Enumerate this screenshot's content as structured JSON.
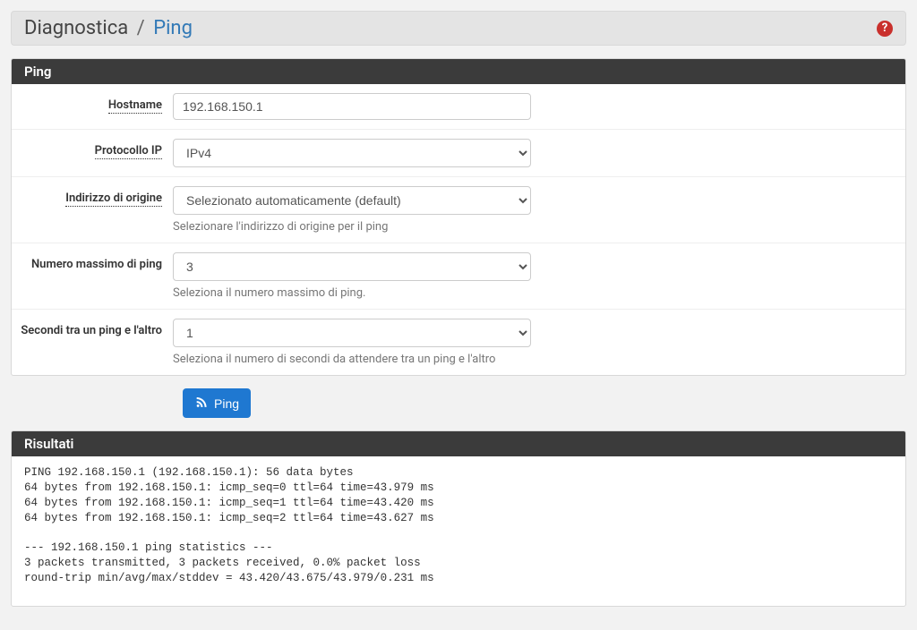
{
  "breadcrumb": {
    "parent": "Diagnostica",
    "separator": "/",
    "current": "Ping"
  },
  "panels": {
    "ping_title": "Ping",
    "results_title": "Risultati"
  },
  "form": {
    "hostname": {
      "label": "Hostname",
      "value": "192.168.150.1"
    },
    "protocol": {
      "label": "Protocollo IP",
      "value": "IPv4"
    },
    "source": {
      "label": "Indirizzo di origine",
      "value": "Selezionato automaticamente (default)",
      "help": "Selezionare l'indirizzo di origine per il ping"
    },
    "maxping": {
      "label": "Numero massimo di ping",
      "value": "3",
      "help": "Seleziona il numero massimo di ping."
    },
    "interval": {
      "label": "Secondi tra un ping e l'altro",
      "value": "1",
      "help": "Seleziona il numero di secondi da attendere tra un ping e l'altro"
    }
  },
  "button": {
    "label": "Ping"
  },
  "results_text": "PING 192.168.150.1 (192.168.150.1): 56 data bytes\n64 bytes from 192.168.150.1: icmp_seq=0 ttl=64 time=43.979 ms\n64 bytes from 192.168.150.1: icmp_seq=1 ttl=64 time=43.420 ms\n64 bytes from 192.168.150.1: icmp_seq=2 ttl=64 time=43.627 ms\n\n--- 192.168.150.1 ping statistics ---\n3 packets transmitted, 3 packets received, 0.0% packet loss\nround-trip min/avg/max/stddev = 43.420/43.675/43.979/0.231 ms"
}
